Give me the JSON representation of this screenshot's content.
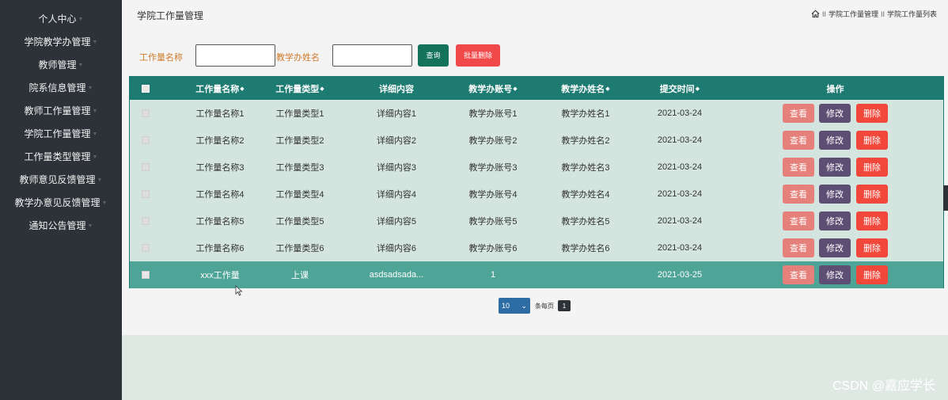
{
  "sidebar": {
    "items": [
      {
        "label": "个人中心"
      },
      {
        "label": "学院教学办管理"
      },
      {
        "label": "教师管理"
      },
      {
        "label": "院系信息管理"
      },
      {
        "label": "教师工作量管理"
      },
      {
        "label": "学院工作量管理"
      },
      {
        "label": "工作量类型管理"
      },
      {
        "label": "教师意见反馈管理"
      },
      {
        "label": "教学办意见反馈管理"
      },
      {
        "label": "通知公告管理"
      }
    ]
  },
  "header": {
    "title": "学院工作量管理",
    "breadcrumb": [
      "学院工作量管理",
      "学院工作量列表"
    ],
    "breadcrumb_sep": "II"
  },
  "search": {
    "field1_label": "工作量名称",
    "field1_value": "",
    "field2_label": "教学办姓名",
    "field2_value": "",
    "search_label": "查询",
    "batch_delete_label": "批量删除"
  },
  "table": {
    "columns": [
      "工作量名称",
      "工作量类型",
      "详细内容",
      "教学办账号",
      "教学办姓名",
      "提交时间",
      "操作"
    ],
    "sort_icon": "sort-arrows",
    "rows": [
      {
        "name": "工作量名称1",
        "type": "工作量类型1",
        "detail": "详细内容1",
        "account": "教学办账号1",
        "person": "教学办姓名1",
        "time": "2021-03-24"
      },
      {
        "name": "工作量名称2",
        "type": "工作量类型2",
        "detail": "详细内容2",
        "account": "教学办账号2",
        "person": "教学办姓名2",
        "time": "2021-03-24"
      },
      {
        "name": "工作量名称3",
        "type": "工作量类型3",
        "detail": "详细内容3",
        "account": "教学办账号3",
        "person": "教学办姓名3",
        "time": "2021-03-24"
      },
      {
        "name": "工作量名称4",
        "type": "工作量类型4",
        "detail": "详细内容4",
        "account": "教学办账号4",
        "person": "教学办姓名4",
        "time": "2021-03-24"
      },
      {
        "name": "工作量名称5",
        "type": "工作量类型5",
        "detail": "详细内容5",
        "account": "教学办账号5",
        "person": "教学办姓名5",
        "time": "2021-03-24"
      },
      {
        "name": "工作量名称6",
        "type": "工作量类型6",
        "detail": "详细内容6",
        "account": "教学办账号6",
        "person": "教学办姓名6",
        "time": "2021-03-24"
      },
      {
        "name": "xxx工作量",
        "type": "上课",
        "detail": "asdsadsada...",
        "account": "1",
        "person": "",
        "time": "2021-03-25"
      }
    ],
    "actions": {
      "view": "查看",
      "edit": "修改",
      "delete": "删除"
    }
  },
  "pagination": {
    "page_size": "10",
    "per_page_label": "条每页",
    "current_page": "1"
  },
  "watermark": "CSDN @嘉应学长",
  "colors": {
    "sidebar_bg": "#2c3237",
    "header_row": "#1e7b72",
    "highlight_row": "#4fa498",
    "search_button": "#12735a",
    "delete_button": "#f2473b",
    "view_button": "#e5807a",
    "edit_button": "#5d4e74",
    "label_orange": "#d07b2c"
  }
}
